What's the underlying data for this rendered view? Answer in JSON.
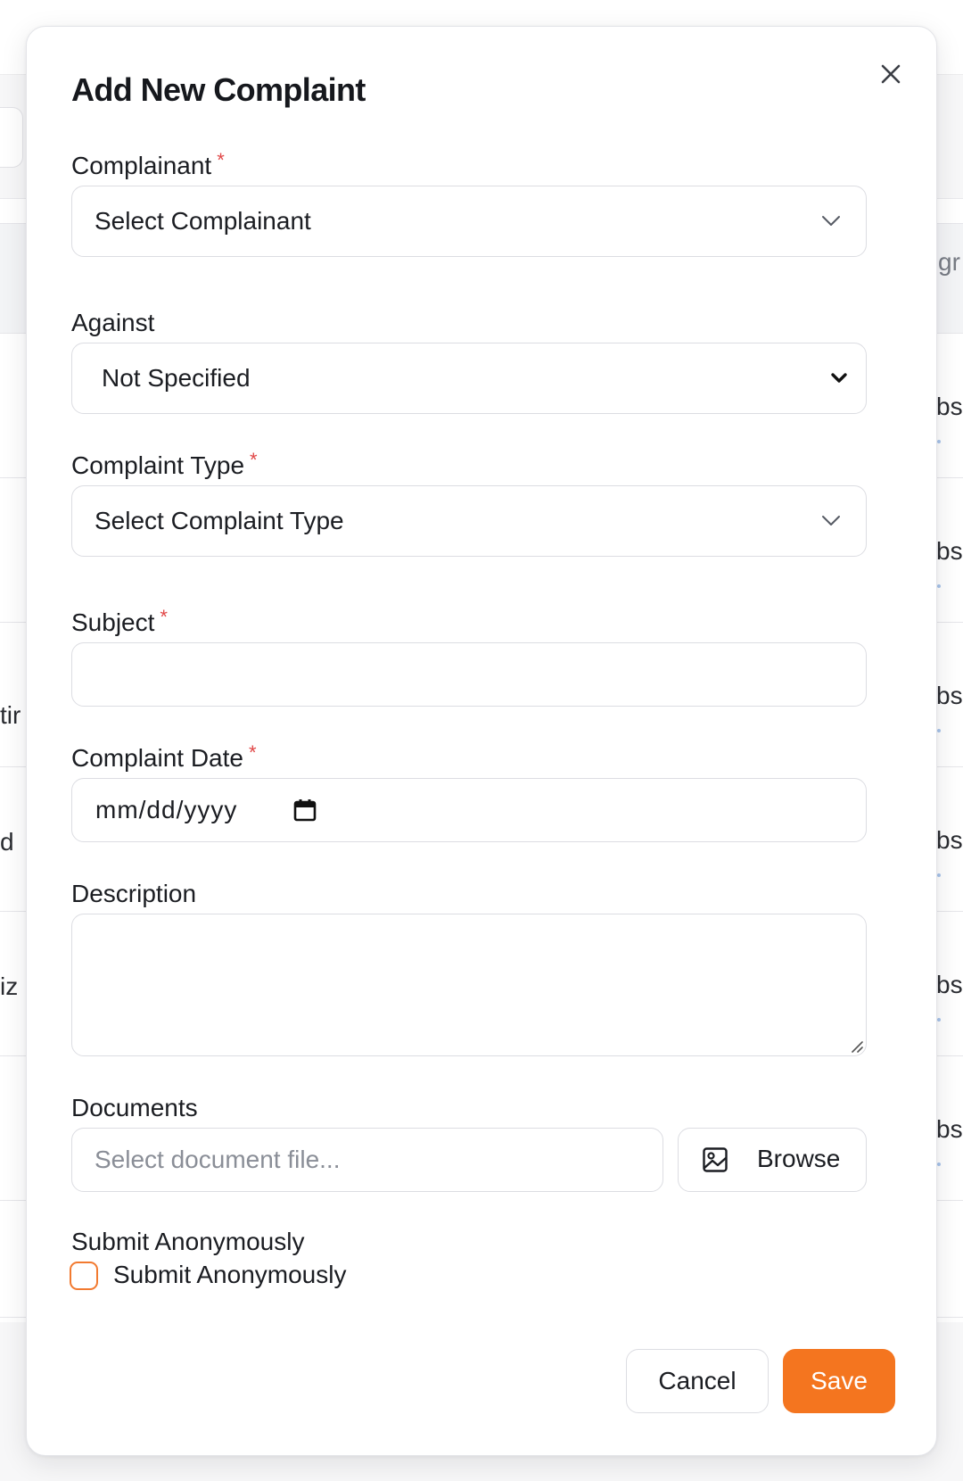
{
  "modal": {
    "title": "Add New Complaint"
  },
  "fields": {
    "complainant": {
      "label": "Complainant",
      "required": "*",
      "value": "Select Complainant"
    },
    "against": {
      "label": "Against",
      "value": "Not Specified"
    },
    "complaint_type": {
      "label": "Complaint Type",
      "required": "*",
      "value": "Select Complaint Type"
    },
    "subject": {
      "label": "Subject",
      "required": "*",
      "value": ""
    },
    "complaint_date": {
      "label": "Complaint Date",
      "required": "*",
      "placeholder": "mm/dd/yyyy"
    },
    "description": {
      "label": "Description",
      "value": ""
    },
    "documents": {
      "label": "Documents",
      "placeholder": "Select document file...",
      "browse_label": "Browse"
    },
    "anonymous": {
      "label": "Submit Anonymously",
      "checkbox_label": "Submit Anonymously",
      "checked": false
    }
  },
  "actions": {
    "cancel_label": "Cancel",
    "save_label": "Save"
  },
  "background": {
    "fragments": [
      "gr",
      "bs",
      "bs",
      "bs",
      "bs",
      "bs",
      "bs",
      "tir",
      "d",
      "iz"
    ]
  },
  "colors": {
    "accent": "#f4751f",
    "required": "#e14747",
    "border": "#dcdde2"
  },
  "icons": {
    "close": "close-icon",
    "select_chevron": "chevron-down-icon",
    "calendar": "calendar-icon",
    "image": "image-icon"
  }
}
